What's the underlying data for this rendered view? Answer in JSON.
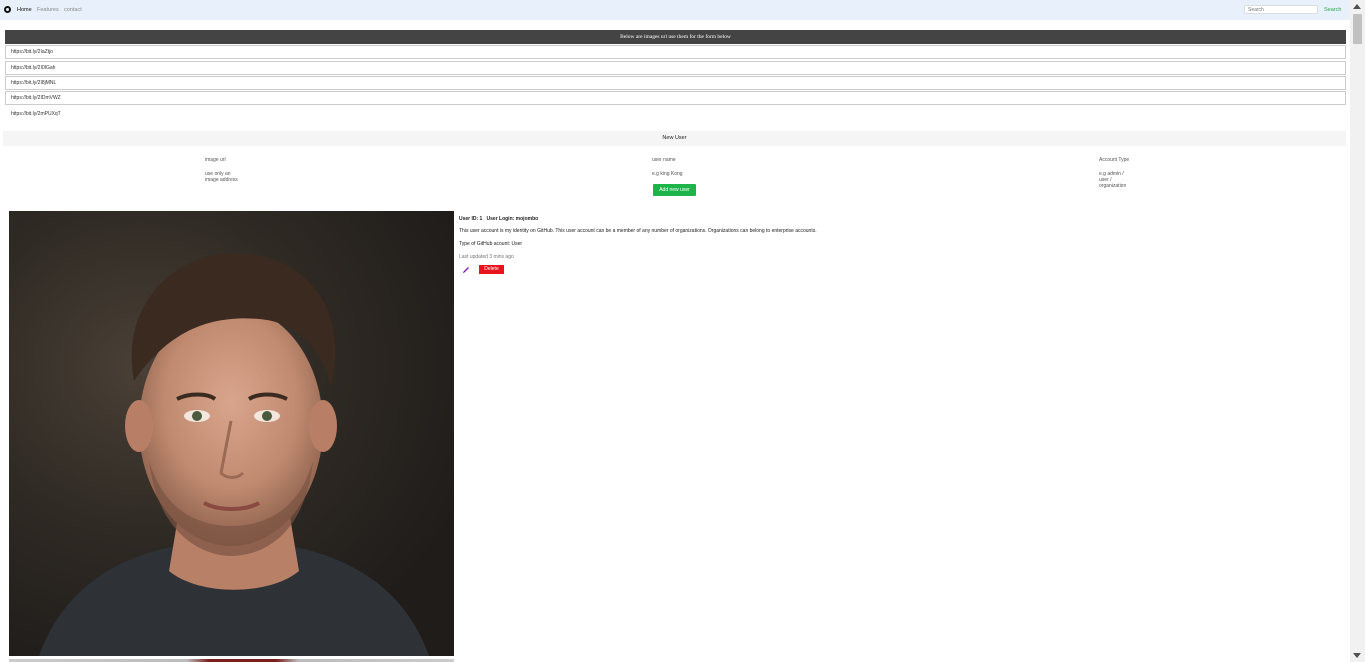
{
  "nav": {
    "links": [
      "Home",
      "Features",
      "contact"
    ],
    "search_placeholder": "Search",
    "search_label": "Search"
  },
  "banner": "Below are images url use them for the form below",
  "image_urls": [
    "https://bit.ly/2IaZtjo",
    "https://bit.ly/2I0IGah",
    "https://bit.ly/2I8jMNL",
    "https://bit.ly/2IDmVWZ",
    "https://bit.ly/2mPUXqT"
  ],
  "new_user": {
    "title": "New User",
    "fields": [
      {
        "label": "image url",
        "hint": [
          "use only an",
          "image address"
        ]
      },
      {
        "label": "user name",
        "hint": [
          "e.g king Kong"
        ]
      },
      {
        "label": "Account Type",
        "hint": [
          "e.g admin /",
          "user /",
          "organization"
        ]
      }
    ],
    "add_label": "Add new user"
  },
  "user_card": {
    "user_id": "User ID: 1",
    "login": "User Login: mojombo",
    "description": "This user account is my identity on GitHub. This user account can be a member of any number of organizations. Organizations can belong to enterprise accounts.",
    "type_line": "Type of GitHub acount: User",
    "updated": "Last updated 3 mins ago",
    "delete_label": "Delete",
    "edit_icon": "pencil-icon"
  },
  "colors": {
    "accent_green": "#1eb44a",
    "delete_red": "#e8131b",
    "banner_bg": "#444444",
    "nav_bg": "#e8f1fb"
  }
}
